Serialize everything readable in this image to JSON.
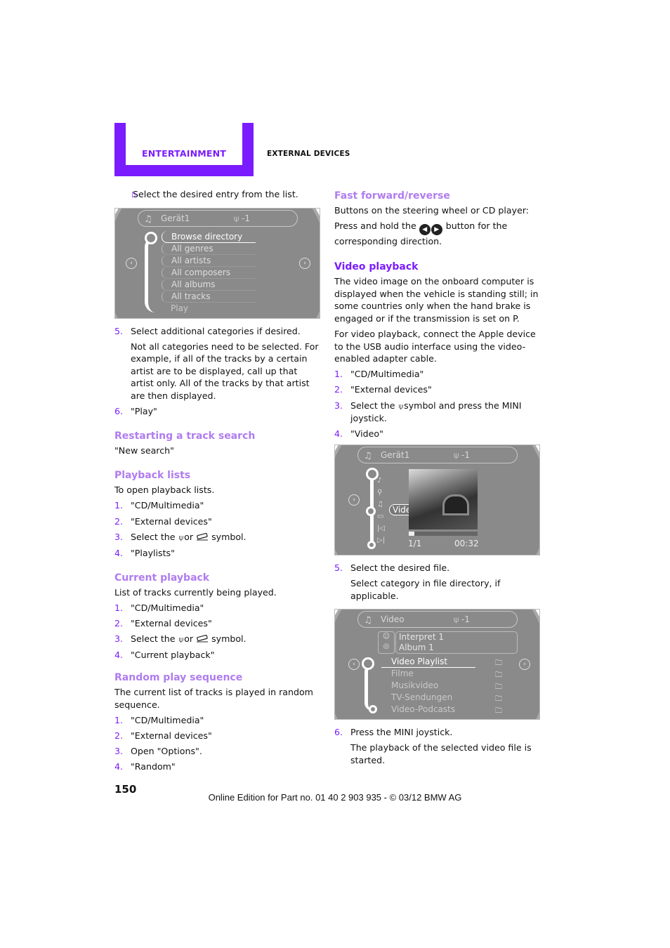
{
  "header": {
    "section": "ENTERTAINMENT",
    "chapter": "EXTERNAL DEVICES",
    "accent_color": "#7a1cff"
  },
  "left": {
    "intro_bullet": "Select the desired entry from the list.",
    "screen1": {
      "title": "Gerät1",
      "usb_label": "-1",
      "items": [
        "Browse directory",
        "All genres",
        "All artists",
        "All composers",
        "All albums",
        "All tracks",
        "Play"
      ],
      "selected": "Browse directory"
    },
    "steps_a": [
      {
        "num": "5.",
        "text": "Select additional categories if desired."
      },
      {
        "num": "",
        "text": "Not all categories need to be selected. For example, if all of the tracks by a certain artist are to be displayed, call up that artist only. All of the tracks by that artist are then displayed."
      },
      {
        "num": "6.",
        "text": "\"Play\""
      }
    ],
    "restart": {
      "heading": "Restarting a track search",
      "text": "\"New search\""
    },
    "playback_lists": {
      "heading": "Playback lists",
      "intro": "To open playback lists.",
      "steps": [
        {
          "num": "1.",
          "text": "\"CD/Multimedia\""
        },
        {
          "num": "2.",
          "text": "\"External devices\""
        },
        {
          "num": "3.",
          "pre": "Select the",
          "mid": "or",
          "post": "symbol."
        },
        {
          "num": "4.",
          "text": "\"Playlists\""
        }
      ]
    },
    "current_playback": {
      "heading": "Current playback",
      "intro": "List of tracks currently being played.",
      "steps": [
        {
          "num": "1.",
          "text": "\"CD/Multimedia\""
        },
        {
          "num": "2.",
          "text": "\"External devices\""
        },
        {
          "num": "3.",
          "pre": "Select the",
          "mid": "or",
          "post": "symbol."
        },
        {
          "num": "4.",
          "text": "\"Current playback\""
        }
      ]
    },
    "random": {
      "heading": "Random play sequence",
      "intro": "The current list of tracks is played in random sequence.",
      "steps": [
        {
          "num": "1.",
          "text": "\"CD/Multimedia\""
        },
        {
          "num": "2.",
          "text": "\"External devices\""
        },
        {
          "num": "3.",
          "text": "Open \"Options\"."
        },
        {
          "num": "4.",
          "text": "\"Random\""
        }
      ]
    }
  },
  "right": {
    "ffwd": {
      "heading": "Fast forward/reverse",
      "text1": "Buttons on the steering wheel or CD player:",
      "text2_pre": "Press and hold the",
      "text2_post": "button for the corresponding direction."
    },
    "video": {
      "heading": "Video playback",
      "p1": "The video image on the onboard computer is displayed when the vehicle is standing still; in some countries only when the hand brake is engaged or if the transmission is set on P.",
      "p2": "For video playback, connect the Apple device to the USB audio interface using the video-enabled adapter cable.",
      "steps": [
        {
          "num": "1.",
          "text": "\"CD/Multimedia\""
        },
        {
          "num": "2.",
          "text": "\"External devices\""
        },
        {
          "num": "3.",
          "pre": "Select the",
          "post": "symbol and press the MINI joystick."
        },
        {
          "num": "4.",
          "text": "\"Video\""
        }
      ],
      "screen2": {
        "title": "Gerät1",
        "usb_label": "-1",
        "selected_label": "Video",
        "track_counter": "1/1",
        "time": "00:32",
        "progress": 0.08
      },
      "steps_b": [
        {
          "num": "5.",
          "text": "Select the desired file."
        },
        {
          "num": "",
          "text": "Select category in file directory, if applicable."
        }
      ],
      "screen3": {
        "title": "Video",
        "usb_label": "-1",
        "artist": "Interpret 1",
        "album": "Album 1",
        "items": [
          "Video Playlist",
          "Filme",
          "Musikvideo",
          "TV-Sendungen",
          "Video-Podcasts"
        ],
        "selected": "Video Playlist"
      },
      "steps_c": [
        {
          "num": "6.",
          "text": "Press the MINI joystick."
        },
        {
          "num": "",
          "text": "The playback of the selected video file is started."
        }
      ]
    }
  },
  "footer": {
    "page_number": "150",
    "edition": "Online Edition for Part no. 01 40 2 903 935 - © 03/12 BMW AG"
  }
}
